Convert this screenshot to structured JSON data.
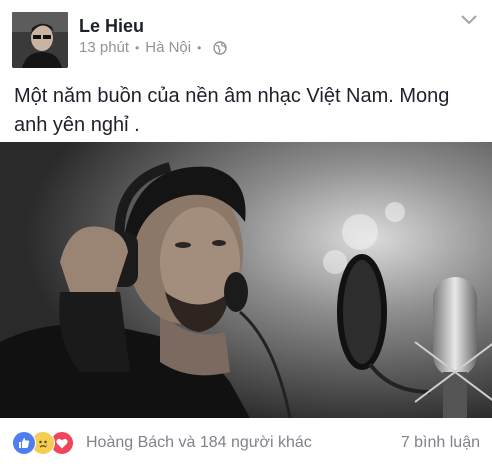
{
  "post": {
    "author": "Le Hieu",
    "time": "13 phút",
    "separator": "•",
    "location": "Hà Nội",
    "text": "Một năm buồn của nền âm nhạc Việt Nam.  Mong anh yên nghỉ .",
    "photo_icon": "photo-of-singer-with-headphones-and-microphone"
  },
  "reactions": {
    "icons": [
      "like-icon",
      "sad-icon",
      "love-icon"
    ],
    "summary": "Hoàng Bách và 184 người khác",
    "comments": "7 bình luận"
  },
  "colors": {
    "like": "#4f7ef0",
    "sad": "#f6cd4f",
    "love": "#f0455d",
    "meta_text": "#90949c",
    "body_text": "#1d2129"
  }
}
